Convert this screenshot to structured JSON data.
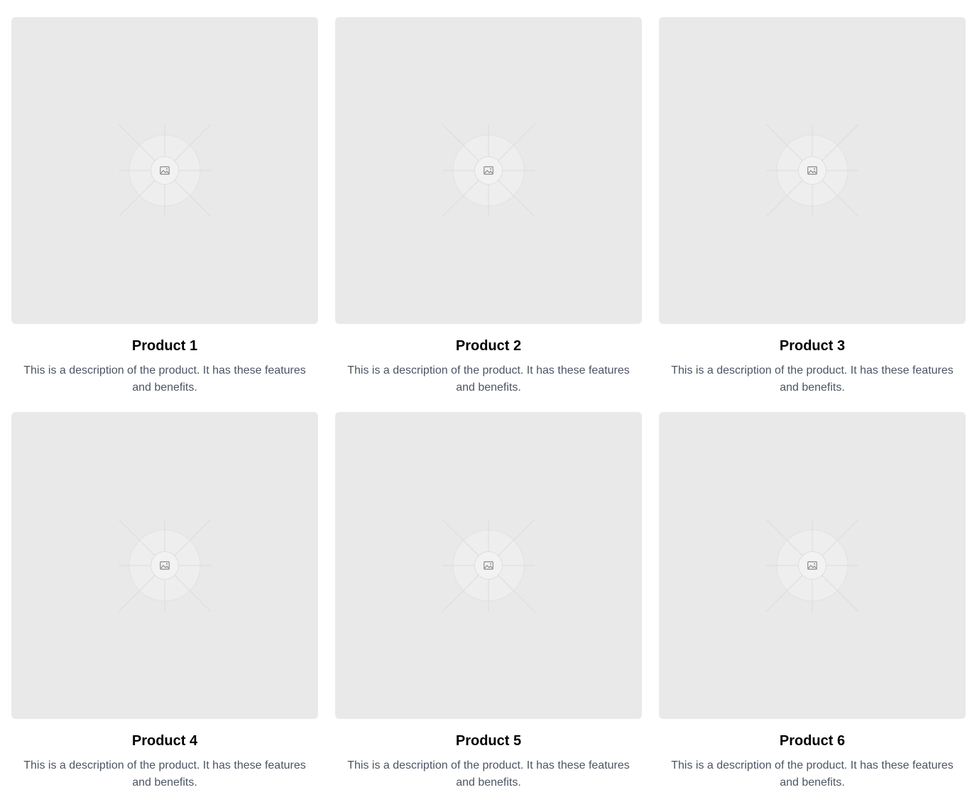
{
  "products": [
    {
      "title": "Product 1",
      "description": "This is a description of the product. It has these features and benefits.",
      "image_icon": "image-icon"
    },
    {
      "title": "Product 2",
      "description": "This is a description of the product. It has these features and benefits.",
      "image_icon": "image-icon"
    },
    {
      "title": "Product 3",
      "description": "This is a description of the product. It has these features and benefits.",
      "image_icon": "image-icon"
    },
    {
      "title": "Product 4",
      "description": "This is a description of the product. It has these features and benefits.",
      "image_icon": "image-icon"
    },
    {
      "title": "Product 5",
      "description": "This is a description of the product. It has these features and benefits.",
      "image_icon": "image-icon"
    },
    {
      "title": "Product 6",
      "description": "This is a description of the product. It has these features and benefits.",
      "image_icon": "image-icon"
    }
  ],
  "colors": {
    "placeholder_bg": "#e9e9e9",
    "title": "#000000",
    "description": "#4b5563"
  }
}
